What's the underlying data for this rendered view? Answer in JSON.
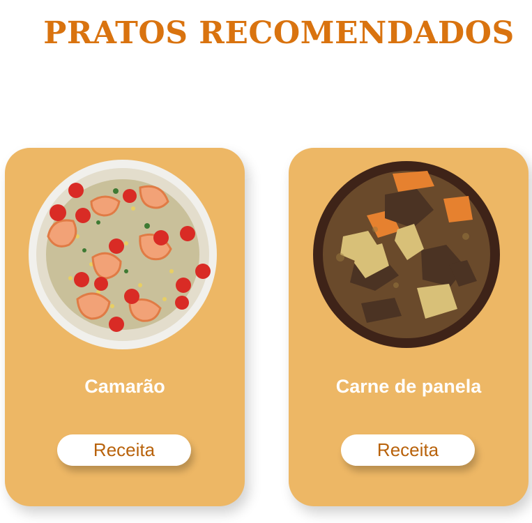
{
  "header": {
    "title": "PRATOS RECOMENDADOS"
  },
  "dishes": [
    {
      "name": "Camarão",
      "button_label": "Receita",
      "image": "shrimp-salad-photo"
    },
    {
      "name": "Carne de panela",
      "button_label": "Receita",
      "image": "beef-stew-photo"
    }
  ],
  "colors": {
    "title": "#d9730f",
    "card_background": "#edb765",
    "button_text": "#b8620b",
    "button_background": "#ffffff",
    "dish_name": "#ffffff"
  }
}
